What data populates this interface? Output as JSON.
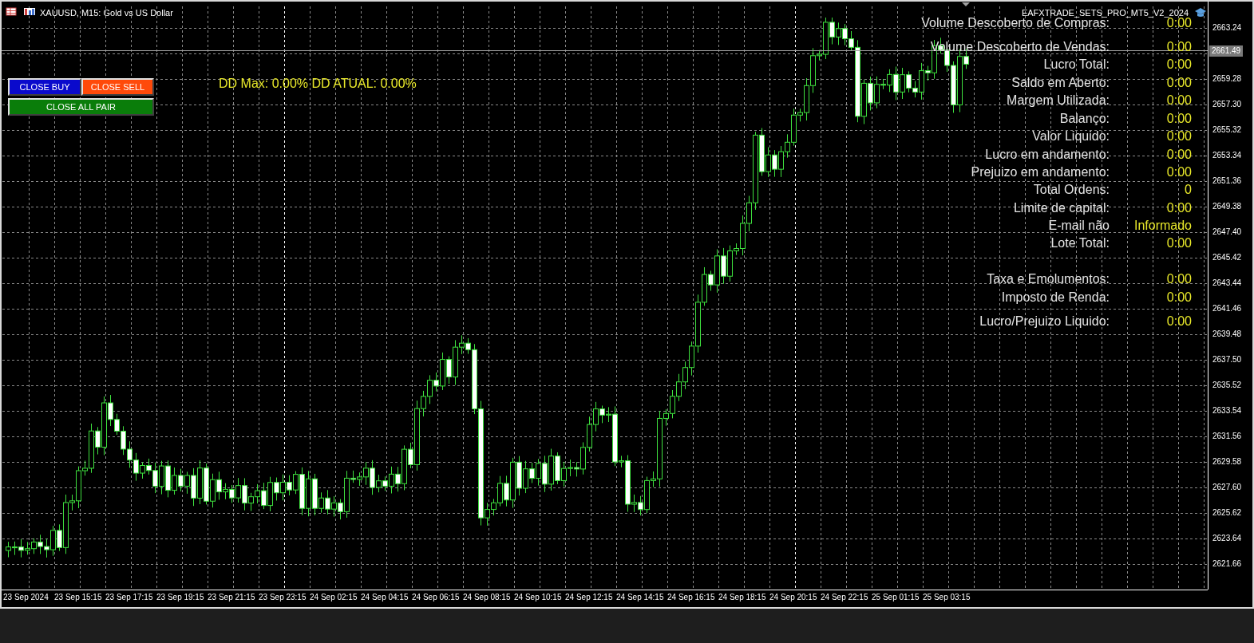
{
  "chart_title": "XAUUSD, M15:  Gold vs US Dollar",
  "buttons": [
    {
      "label": "CLOSE BUY",
      "color": "#0a0acc"
    },
    {
      "label": "CLOSE SELL",
      "color": "#ff4a0a"
    },
    {
      "label": "CLOSE ALL PAIR",
      "color": "#0a7d0a"
    }
  ],
  "dd_text": "DD Max: 0.00% DD ATUAL: 0.00%",
  "expert_name": "EAFXTRADE_SETS_PRO_MT5_V2_2024",
  "panel_rows": [
    {
      "label": "Volume Descoberto de Compras:",
      "value": "0:00"
    },
    {
      "label": "Volume Descoberto de Vendas:",
      "value": "0:00"
    },
    {
      "label": "Lucro Total:",
      "value": "0:00"
    },
    {
      "label": "Saldo em Aberto:",
      "value": "0:00"
    },
    {
      "label": "Margem Utilizada:",
      "value": "0:00"
    },
    {
      "label": "Balanço:",
      "value": "0:00"
    },
    {
      "label": "Valor Liquido:",
      "value": "0:00"
    },
    {
      "label": "Lucro em andamento:",
      "value": "0:00"
    },
    {
      "label": "Prejuizo em andamento:",
      "value": "0:00"
    },
    {
      "label": "Total Ordens:",
      "value": "0"
    },
    {
      "label": "Limite de capital:",
      "value": "0:00"
    },
    {
      "label": "E-mail não",
      "value": "Informado"
    },
    {
      "label": "Lote Total:",
      "value": "0:00"
    },
    {
      "label": "Taxa e Emolumentos:",
      "value": "0:00"
    },
    {
      "label": "Imposto de Renda:",
      "value": "0:00"
    },
    {
      "label": "Lucro/Prejuizo Liquido:",
      "value": "0:00"
    }
  ],
  "price_axis": {
    "current_price": "2661.49",
    "ticks": [
      "2663.24",
      "2659.28",
      "2657.30",
      "2655.32",
      "2653.34",
      "2651.36",
      "2649.38",
      "2647.40",
      "2645.42",
      "2643.44",
      "2641.46",
      "2639.48",
      "2637.50",
      "2635.52",
      "2633.54",
      "2631.56",
      "2629.58",
      "2627.60",
      "2625.62",
      "2623.64",
      "2621.66"
    ]
  },
  "time_axis": {
    "labels": [
      "23 Sep 2024",
      "23 Sep 15:15",
      "23 Sep 17:15",
      "23 Sep 19:15",
      "23 Sep 21:15",
      "23 Sep 23:15",
      "24 Sep 02:15",
      "24 Sep 04:15",
      "24 Sep 06:15",
      "24 Sep 08:15",
      "24 Sep 10:15",
      "24 Sep 12:15",
      "24 Sep 14:15",
      "24 Sep 16:15",
      "24 Sep 18:15",
      "24 Sep 20:15",
      "24 Sep 22:15",
      "25 Sep 01:15",
      "25 Sep 03:15"
    ]
  }
}
